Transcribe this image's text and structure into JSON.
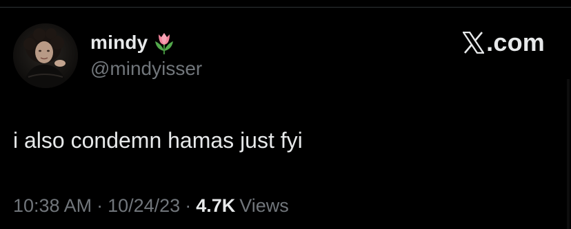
{
  "author": {
    "display_name": "mindy",
    "handle": "@mindyisser",
    "name_emoji_icon": "tulip-icon",
    "avatar": "profile-photo"
  },
  "brand": {
    "logo_icon": "x-logo-icon",
    "text": ".com"
  },
  "tweet": {
    "text": "i also condemn hamas just fyi"
  },
  "meta": {
    "time": "10:38 AM",
    "separator": "·",
    "date": "10/24/23",
    "views_count": "4.7K",
    "views_label": "Views"
  },
  "colors": {
    "background": "#000000",
    "primary_text": "#e7e9ea",
    "secondary_text": "#71767b",
    "divider": "#2f3336"
  }
}
